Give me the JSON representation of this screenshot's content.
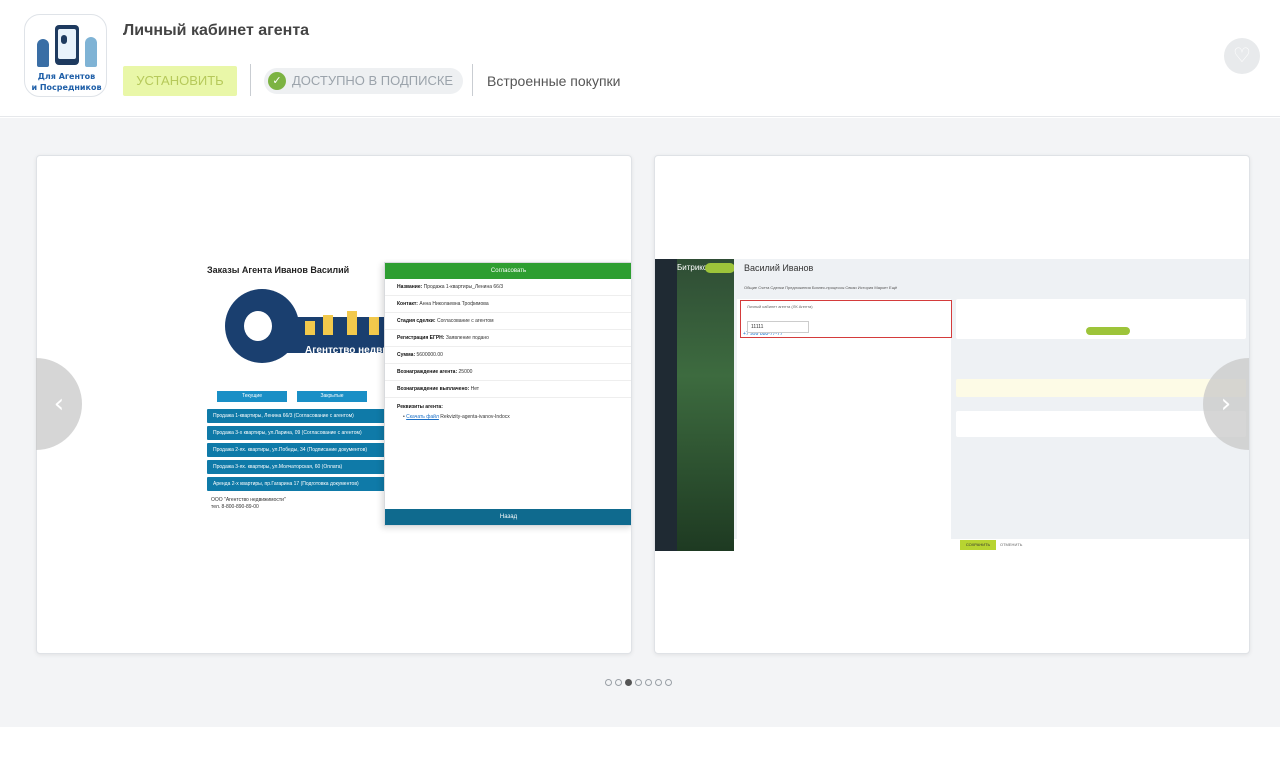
{
  "app": {
    "title": "Личный кабинет агента",
    "icon_caption_line1": "Для Агентов",
    "icon_caption_line2": "и Посредников",
    "install_label": "УСТАНОВИТЬ",
    "subscription_label": "ДОСТУПНО В ПОДПИСКЕ",
    "inapp_label": "Встроенные покупки",
    "colors": {
      "install_bg": "#e9f7a8",
      "check": "#7cb342",
      "accent_green": "#2e9e31"
    }
  },
  "slide1": {
    "heading": "Заказы Агента Иванов Василий",
    "logo_text": "Агентство недвиж",
    "tabs": [
      "Текущие",
      "Закрытые"
    ],
    "rows": [
      "Продажа 1-квартиры, Ленина 66/3 (Согласование с агентом)",
      "Продажа 3-х квартиры, ул.Ларина, 09 (Согласование с агентом)",
      "Продажа 2-ях. квартиры, ул.Победы, 34 (Подписание документов)",
      "Продажа 3-ях. квартиры, ул.Молчаторская, 60 (Оплата)",
      "Аренда 2-х квартиры, пр.Гагарина 17 (Подготовка документов)"
    ],
    "footer_line1": "ООО \"Агентство недвижимости\"",
    "footer_line2": "тел. 8-800-890-89-00",
    "panel": {
      "header": "Согласовать",
      "fields": [
        {
          "label": "Название:",
          "value": "Продажа 1-квартиры_Ленина 66/3"
        },
        {
          "label": "Контакт:",
          "value": "Анна Николаевна Трофимова"
        },
        {
          "label": "Стадия сделки:",
          "value": "Согласование с агентом"
        },
        {
          "label": "Регистрация ЕГРН:",
          "value": "Заявление подано"
        },
        {
          "label": "Сумма:",
          "value": "5600000.00"
        },
        {
          "label": "Вознаграждение агента:",
          "value": "25000"
        },
        {
          "label": "Вознаграждение выплачено:",
          "value": "Нет"
        }
      ],
      "requisites_title": "Реквизиты агента:",
      "requisites_link": "Скачать файл",
      "requisites_file": "Rekvizity-agenta-ivanov-Indocx",
      "footer": "Назад"
    }
  },
  "slide2": {
    "bitrix": "Битрикс",
    "contact_name": "Василий Иванов",
    "tabs_line": "Общие   Счета   Сделки   Предложения   Бизнес-процессы   Связи   История   Маркет   Ещё",
    "phone": "+7 999 888-77-77",
    "checkbox_label": "Личный кабинет агента (ЛК Агента)",
    "field_value": "11111",
    "save_label": "СОХРАНИТЬ",
    "cancel_label": "ОТМЕНИТЬ"
  },
  "carousel": {
    "prev_icon": "‹",
    "next_icon": "›",
    "dot_count": 7,
    "active_dot": 2
  }
}
